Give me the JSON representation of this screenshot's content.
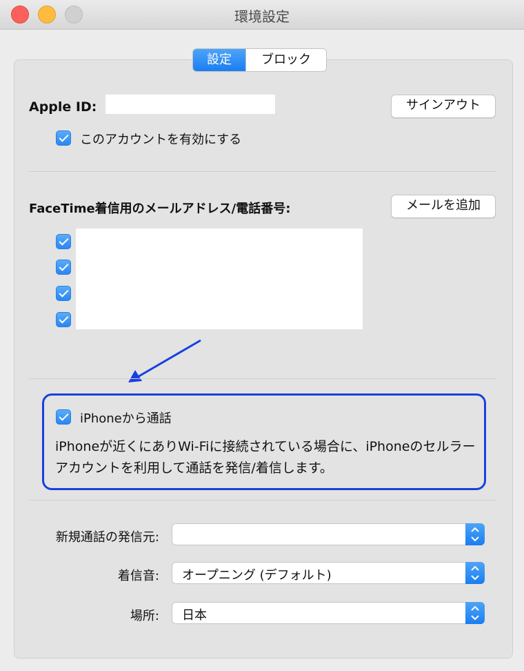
{
  "window": {
    "title": "環境設定"
  },
  "tabs": [
    {
      "label": "設定",
      "active": true
    },
    {
      "label": "ブロック",
      "active": false
    }
  ],
  "account": {
    "apple_id_label": "Apple ID:",
    "apple_id_value": "",
    "signout_label": "サインアウト",
    "enable_label": "このアカウントを有効にする",
    "enable_checked": true
  },
  "facetime": {
    "heading": "FaceTime着信用のメールアドレス/電話番号:",
    "add_email_label": "メールを追加",
    "addresses": [
      {
        "checked": true,
        "value": ""
      },
      {
        "checked": true,
        "value": ""
      },
      {
        "checked": true,
        "value": ""
      },
      {
        "checked": true,
        "value": ""
      }
    ]
  },
  "iphone_calls": {
    "label": "iPhoneから通話",
    "checked": true,
    "description": "iPhoneが近くにありWi-Fiに接続されている場合に、iPhoneのセルラーアカウントを利用して通話を発信/着信します。"
  },
  "settings": {
    "caller_id_label": "新規通話の発信元:",
    "caller_id_value": "",
    "ringtone_label": "着信音:",
    "ringtone_value": "オープニング (デフォルト)",
    "location_label": "場所:",
    "location_value": "日本"
  },
  "colors": {
    "accent": "#1a7ef1",
    "annotation": "#1740e0"
  },
  "icons": {
    "annotation_arrow": "arrow-down-left-icon",
    "popup_stepper": "chevron-up-down-icon"
  }
}
